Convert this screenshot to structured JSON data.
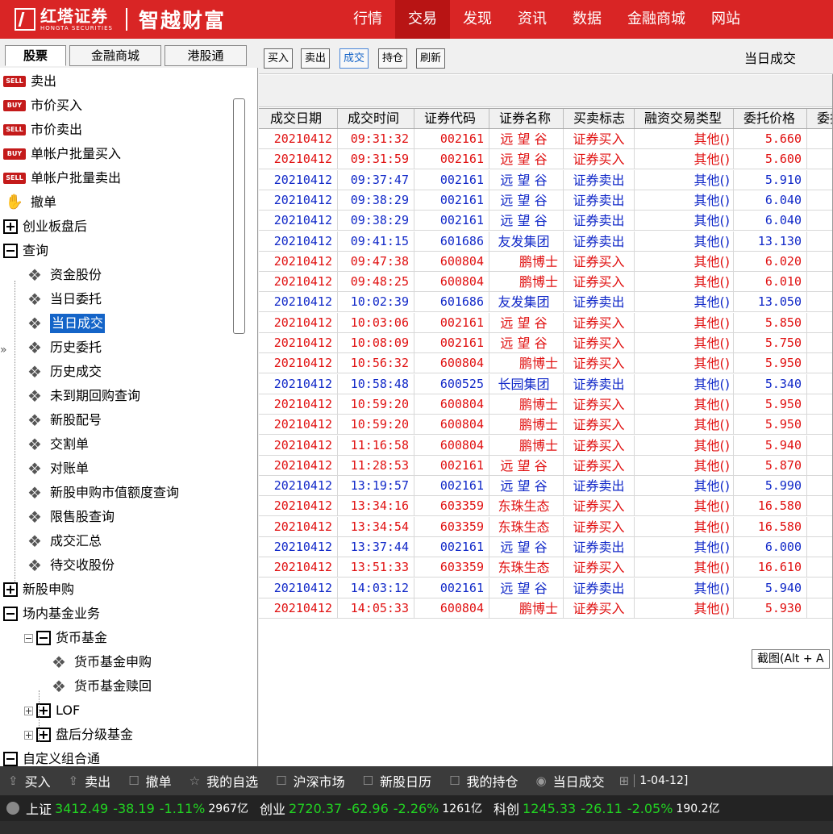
{
  "header": {
    "logo_cn": "红塔证券",
    "logo_en": "HONGTA SECURITIES",
    "slogan": "智越财富",
    "nav": [
      "行情",
      "交易",
      "发现",
      "资讯",
      "数据",
      "金融商城",
      "网站"
    ],
    "active_nav": "交易"
  },
  "left_tabs": [
    "股票",
    "金融商城",
    "港股通"
  ],
  "tree": [
    {
      "label": "卖出",
      "icon": "sell-icon"
    },
    {
      "label": "市价买入",
      "icon": "buy-icon"
    },
    {
      "label": "市价卖出",
      "icon": "sell-icon"
    },
    {
      "label": "单帐户批量买入",
      "icon": "buy-icon"
    },
    {
      "label": "单帐户批量卖出",
      "icon": "sell-icon"
    },
    {
      "label": "撤单",
      "icon": "hand-icon"
    },
    {
      "label": "创业板盘后",
      "icon": "expand-icon"
    },
    {
      "label": "查询",
      "icon": "collapse-icon"
    },
    {
      "label": "资金股份",
      "icon": "leaf-icon"
    },
    {
      "label": "当日委托",
      "icon": "leaf-icon"
    },
    {
      "label": "当日成交",
      "icon": "leaf-icon"
    },
    {
      "label": "历史委托",
      "icon": "leaf-icon"
    },
    {
      "label": "历史成交",
      "icon": "leaf-icon"
    },
    {
      "label": "未到期回购查询",
      "icon": "leaf-icon"
    },
    {
      "label": "新股配号",
      "icon": "leaf-icon"
    },
    {
      "label": "交割单",
      "icon": "leaf-icon"
    },
    {
      "label": "对账单",
      "icon": "leaf-icon"
    },
    {
      "label": "新股申购市值额度查询",
      "icon": "leaf-icon"
    },
    {
      "label": "限售股查询",
      "icon": "leaf-icon"
    },
    {
      "label": "成交汇总",
      "icon": "leaf-icon"
    },
    {
      "label": "待交收股份",
      "icon": "leaf-icon"
    },
    {
      "label": "新股申购",
      "icon": "expand-icon"
    },
    {
      "label": "场内基金业务",
      "icon": "collapse-icon"
    },
    {
      "label": "货币基金",
      "icon": "collapse-icon"
    },
    {
      "label": "货币基金申购",
      "icon": "leaf-icon"
    },
    {
      "label": "货币基金赎回",
      "icon": "leaf-icon"
    },
    {
      "label": "LOF",
      "icon": "expand-icon"
    },
    {
      "label": "盘后分级基金",
      "icon": "expand-icon"
    },
    {
      "label": "自定义组合通",
      "icon": "collapse-icon"
    }
  ],
  "selected_tree_item": "当日成交",
  "toolbar": {
    "buttons": [
      "买入",
      "卖出",
      "成交",
      "持仓",
      "刷新"
    ],
    "active": "成交",
    "title": "当日成交"
  },
  "table": {
    "headers": [
      "成交日期",
      "成交时间",
      "证券代码",
      "证券名称",
      "买卖标志",
      "融资交易类型",
      "委托价格",
      "委托"
    ],
    "rows": [
      [
        "20210412",
        "09:31:32",
        "002161",
        "远 望 谷",
        "证券买入",
        "其他()",
        "5.660"
      ],
      [
        "20210412",
        "09:31:59",
        "002161",
        "远 望 谷",
        "证券买入",
        "其他()",
        "5.600"
      ],
      [
        "20210412",
        "09:37:47",
        "002161",
        "远 望 谷",
        "证券卖出",
        "其他()",
        "5.910"
      ],
      [
        "20210412",
        "09:38:29",
        "002161",
        "远 望 谷",
        "证券卖出",
        "其他()",
        "6.040"
      ],
      [
        "20210412",
        "09:38:29",
        "002161",
        "远 望 谷",
        "证券卖出",
        "其他()",
        "6.040"
      ],
      [
        "20210412",
        "09:41:15",
        "601686",
        "友发集团",
        "证券卖出",
        "其他()",
        "13.130"
      ],
      [
        "20210412",
        "09:47:38",
        "600804",
        "鹏博士",
        "证券买入",
        "其他()",
        "6.020"
      ],
      [
        "20210412",
        "09:48:25",
        "600804",
        "鹏博士",
        "证券买入",
        "其他()",
        "6.010"
      ],
      [
        "20210412",
        "10:02:39",
        "601686",
        "友发集团",
        "证券卖出",
        "其他()",
        "13.050"
      ],
      [
        "20210412",
        "10:03:06",
        "002161",
        "远 望 谷",
        "证券买入",
        "其他()",
        "5.850"
      ],
      [
        "20210412",
        "10:08:09",
        "002161",
        "远 望 谷",
        "证券买入",
        "其他()",
        "5.750"
      ],
      [
        "20210412",
        "10:56:32",
        "600804",
        "鹏博士",
        "证券买入",
        "其他()",
        "5.950"
      ],
      [
        "20210412",
        "10:58:48",
        "600525",
        "长园集团",
        "证券卖出",
        "其他()",
        "5.340"
      ],
      [
        "20210412",
        "10:59:20",
        "600804",
        "鹏博士",
        "证券买入",
        "其他()",
        "5.950"
      ],
      [
        "20210412",
        "10:59:20",
        "600804",
        "鹏博士",
        "证券买入",
        "其他()",
        "5.950"
      ],
      [
        "20210412",
        "11:16:58",
        "600804",
        "鹏博士",
        "证券买入",
        "其他()",
        "5.940"
      ],
      [
        "20210412",
        "11:28:53",
        "002161",
        "远 望 谷",
        "证券买入",
        "其他()",
        "5.870"
      ],
      [
        "20210412",
        "13:19:57",
        "002161",
        "远 望 谷",
        "证券卖出",
        "其他()",
        "5.990"
      ],
      [
        "20210412",
        "13:34:16",
        "603359",
        "东珠生态",
        "证券买入",
        "其他()",
        "16.580"
      ],
      [
        "20210412",
        "13:34:54",
        "603359",
        "东珠生态",
        "证券买入",
        "其他()",
        "16.580"
      ],
      [
        "20210412",
        "13:37:44",
        "002161",
        "远 望 谷",
        "证券卖出",
        "其他()",
        "6.000"
      ],
      [
        "20210412",
        "13:51:33",
        "603359",
        "东珠生态",
        "证券买入",
        "其他()",
        "16.610"
      ],
      [
        "20210412",
        "14:03:12",
        "002161",
        "远 望 谷",
        "证券卖出",
        "其他()",
        "5.940"
      ],
      [
        "20210412",
        "14:05:33",
        "600804",
        "鹏博士",
        "证券买入",
        "其他()",
        "5.930"
      ]
    ]
  },
  "tooltip": "截图(Alt + A",
  "taskbar": [
    {
      "label": "买入",
      "icon": "buy-arrow-icon"
    },
    {
      "label": "卖出",
      "icon": "sell-arrow-icon"
    },
    {
      "label": "撤单",
      "icon": "cancel-order-icon"
    },
    {
      "label": "我的自选",
      "icon": "watchlist-icon"
    },
    {
      "label": "沪深市场",
      "icon": "market-icon"
    },
    {
      "label": "新股日历",
      "icon": "calendar-icon"
    },
    {
      "label": "我的持仓",
      "icon": "holdings-icon"
    },
    {
      "label": "当日成交",
      "icon": "trades-icon"
    }
  ],
  "taskbar_date": "1-04-12]",
  "indices": [
    {
      "name": "上证",
      "value": "3412.49",
      "change": "-38.19",
      "pct": "-1.11%",
      "volume": "2967亿"
    },
    {
      "name": "创业",
      "value": "2720.37",
      "change": "-62.96",
      "pct": "-2.26%",
      "volume": "1261亿"
    },
    {
      "name": "科创",
      "value": "1245.33",
      "change": "-26.11",
      "pct": "-2.05%",
      "volume": "190.2亿"
    }
  ],
  "colors": {
    "header_bg": "#d92525",
    "buy_text": "#e01010",
    "sell_text": "#1028c8",
    "down_text": "#22d422",
    "selected_bg": "#1464c8"
  }
}
